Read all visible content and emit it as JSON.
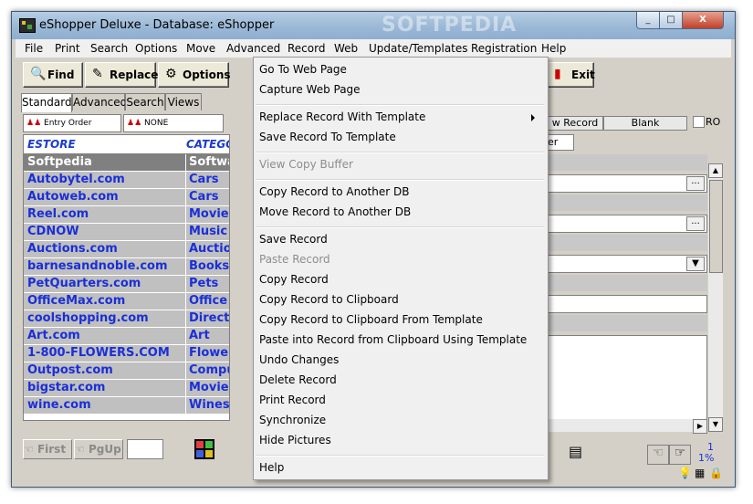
{
  "window": {
    "title": "eShopper Deluxe - Database: eShopper",
    "watermark": "SOFTPEDIA",
    "controls": {
      "minimize": "_",
      "maximize": "□",
      "close": "X"
    }
  },
  "menubar": [
    "File",
    "Print",
    "Search",
    "Options",
    "Move",
    "Advanced",
    "Record",
    "Web",
    "Update/Templates",
    "Registration",
    "Help"
  ],
  "toolbar": {
    "find": "Find",
    "replace": "Replace",
    "options": "Options",
    "exit": "Exit"
  },
  "tabs": [
    "Standard",
    "Advanced",
    "Search",
    "Views"
  ],
  "sort": {
    "primary": "Entry Order",
    "secondary": "NONE"
  },
  "grid": {
    "headers": [
      "ESTORE",
      "CATEGORY"
    ],
    "rows": [
      [
        "Softpedia",
        "Software"
      ],
      [
        "Autobytel.com",
        "Cars"
      ],
      [
        "Autoweb.com",
        "Cars"
      ],
      [
        "Reel.com",
        "Movies"
      ],
      [
        "CDNOW",
        "Music"
      ],
      [
        "Auctions.com",
        "Auctions"
      ],
      [
        "barnesandnoble.com",
        "Books"
      ],
      [
        "PetQuarters.com",
        "Pets"
      ],
      [
        "OfficeMax.com",
        "Office"
      ],
      [
        "coolshopping.com",
        "Directory"
      ],
      [
        "Art.com",
        "Art"
      ],
      [
        "1-800-FLOWERS.COM",
        "Flowers"
      ],
      [
        "Outpost.com",
        "Computers"
      ],
      [
        "bigstar.com",
        "Movies"
      ],
      [
        "wine.com",
        "Wines"
      ]
    ],
    "selected_index": 0
  },
  "navigation": {
    "first": "First",
    "pgup": "PgUp"
  },
  "right_panel": {
    "new_record": "w Record",
    "blank": "Blank",
    "ro": "RO",
    "tab_fragment": "er"
  },
  "status": {
    "count": "1",
    "percent": "1%"
  },
  "context_menu": {
    "items": [
      {
        "label": "Go To Web Page",
        "enabled": true
      },
      {
        "label": "Capture Web Page",
        "enabled": true
      },
      {
        "label": "Replace Record With Template",
        "enabled": true,
        "submenu": true
      },
      {
        "label": "Save Record To Template",
        "enabled": true
      },
      {
        "label": "View Copy Buffer",
        "enabled": false
      },
      {
        "label": "Copy Record to Another DB",
        "enabled": true
      },
      {
        "label": "Move Record to Another DB",
        "enabled": true
      },
      {
        "label": "Save Record",
        "enabled": true
      },
      {
        "label": "Paste Record",
        "enabled": false
      },
      {
        "label": "Copy Record",
        "enabled": true
      },
      {
        "label": "Copy Record to Clipboard",
        "enabled": true
      },
      {
        "label": "Copy Record to Clipboard From Template",
        "enabled": true
      },
      {
        "label": "Paste into Record from Clipboard Using Template",
        "enabled": true
      },
      {
        "label": "Undo Changes",
        "enabled": true
      },
      {
        "label": "Delete Record",
        "enabled": true
      },
      {
        "label": "Print Record",
        "enabled": true
      },
      {
        "label": "Synchronize",
        "enabled": true
      },
      {
        "label": "Hide Pictures",
        "enabled": true
      },
      {
        "label": "Help",
        "enabled": true
      }
    ]
  }
}
